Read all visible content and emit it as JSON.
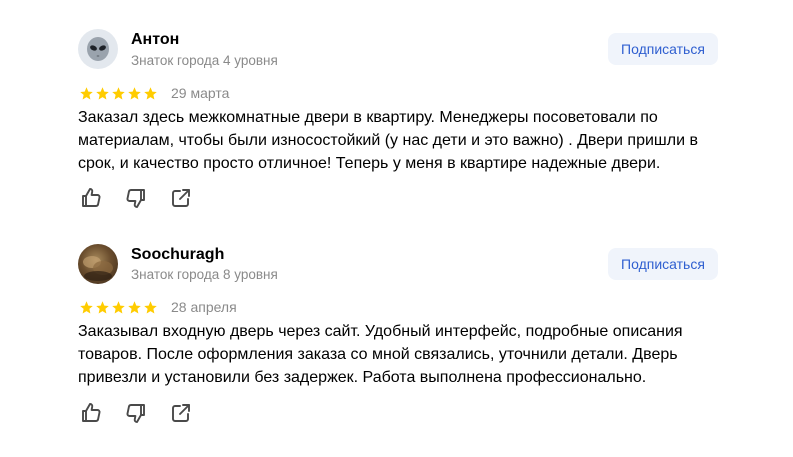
{
  "reviews": [
    {
      "author": "Антон",
      "badge": "Знаток города 4 уровня",
      "subscribe_label": "Подписаться",
      "rating": 5,
      "date": "29 марта",
      "text": "Заказал здесь межкомнатные двери в квартиру. Менеджеры посоветовали по материалам, чтобы были износостойкий (у нас дети и это важно) . Двери пришли в срок, и качество просто отличное! Теперь у меня в квартире надежные двери.",
      "avatar_icon": "alien-icon"
    },
    {
      "author": "Soochuragh",
      "badge": "Знаток города 8 уровня",
      "subscribe_label": "Подписаться",
      "rating": 5,
      "date": "28 апреля",
      "text": "Заказывал входную дверь через сайт. Удобный интерфейс, подробные описания товаров. После оформления заказа со мной связались, уточнили детали. Дверь привезли и установили без задержек. Работа выполнена профессионально.",
      "avatar_icon": "user-photo"
    }
  ],
  "colors": {
    "star": "#ffcc00",
    "accent": "#2f5fd0",
    "button_bg": "#f0f4fb",
    "muted": "#8a8a8a",
    "icon": "#4a4a4a"
  }
}
